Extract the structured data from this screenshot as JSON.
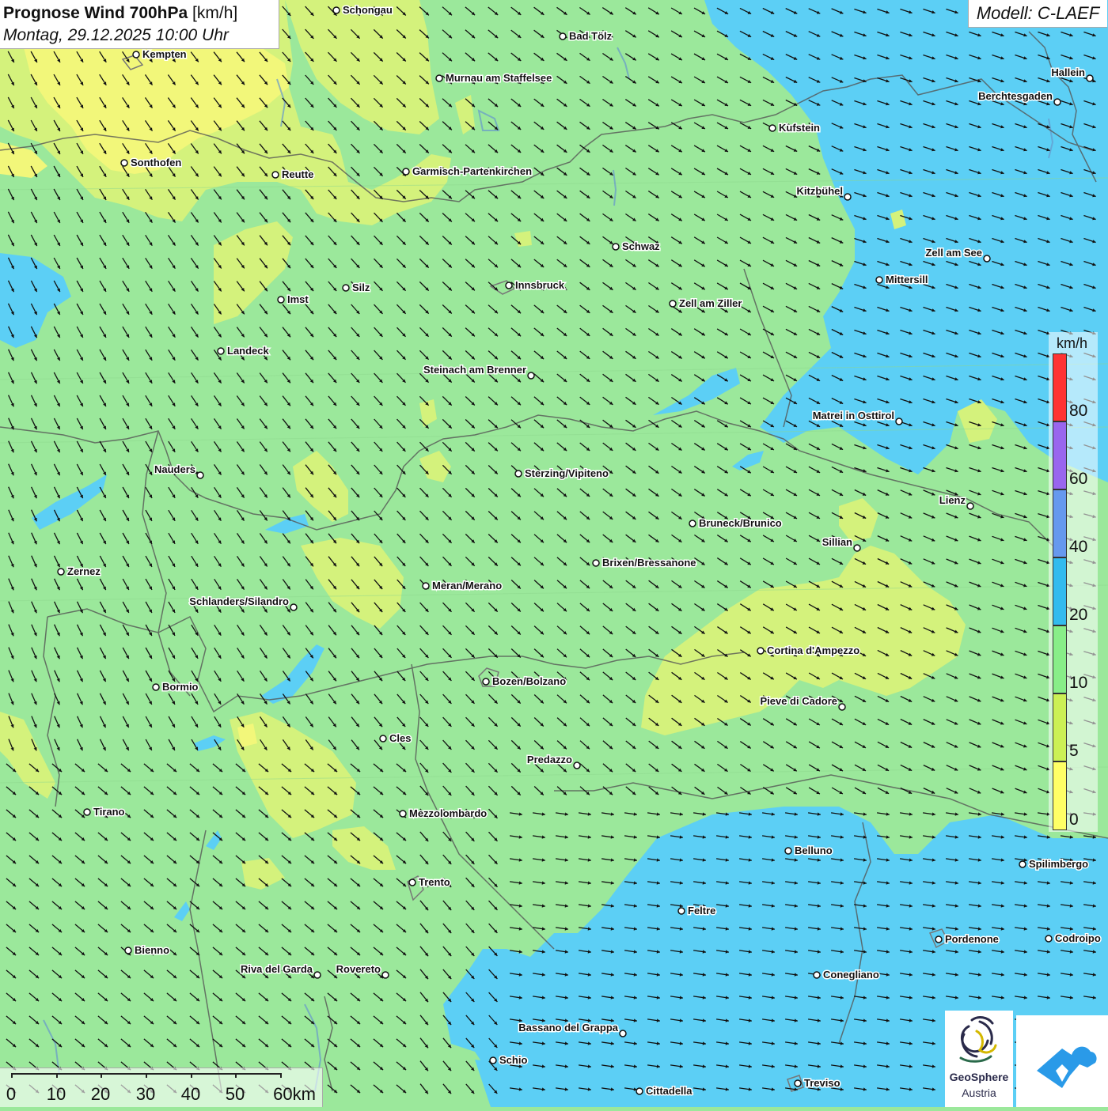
{
  "header": {
    "title_bold": "Prognose Wind 700hPa",
    "title_unit": "[km/h]",
    "datetime": "Montag, 29.12.2025 10:00 Uhr",
    "model": "Modell: C-LAEF"
  },
  "legend": {
    "unit": "km/h",
    "labels": [
      "80",
      "60",
      "40",
      "20",
      "10",
      "5",
      "0"
    ],
    "colors": {
      "above_80": "#ff3333",
      "60_80": "#9966ee",
      "40_60": "#6699ee",
      "20_40": "#33bbee",
      "10_20": "#88ee88",
      "5_10": "#ccf055",
      "0_5": "#ffff66"
    }
  },
  "scale": {
    "labels": [
      "0",
      "10",
      "20",
      "30",
      "40",
      "50",
      "60km"
    ]
  },
  "logos": {
    "geosphere_line1": "GeoSphere",
    "geosphere_line2": "Austria"
  },
  "map_colors": {
    "green": "#9be89b",
    "yellow_green": "#d4f27c",
    "yellow": "#f2f77a",
    "blue": "#5ccff5",
    "border": "#555555",
    "arrow": "#111111"
  },
  "cities": [
    {
      "name": "Schongau",
      "side": "right"
    },
    {
      "name": "Bad Tölz",
      "side": "right"
    },
    {
      "name": "Kempten",
      "side": "right"
    },
    {
      "name": "Murnau am Staffelsee",
      "side": "right"
    },
    {
      "name": "Hallein",
      "side": "left"
    },
    {
      "name": "Berchtesgaden",
      "side": "left"
    },
    {
      "name": "Kufstein",
      "side": "right"
    },
    {
      "name": "Sonthofen",
      "side": "right"
    },
    {
      "name": "Reutte",
      "side": "right"
    },
    {
      "name": "Garmisch-Partenkirchen",
      "side": "right"
    },
    {
      "name": "Kitzbühel",
      "side": "left"
    },
    {
      "name": "Schwaz",
      "side": "right"
    },
    {
      "name": "Zell am See",
      "side": "left"
    },
    {
      "name": "Mittersill",
      "side": "right"
    },
    {
      "name": "Innsbruck",
      "side": "right"
    },
    {
      "name": "Silz",
      "side": "right"
    },
    {
      "name": "Imst",
      "side": "right"
    },
    {
      "name": "Zell am Ziller",
      "side": "right"
    },
    {
      "name": "Landeck",
      "side": "right"
    },
    {
      "name": "Steinach am Brenner",
      "side": "left"
    },
    {
      "name": "Matrei in Osttirol",
      "side": "left"
    },
    {
      "name": "Nauders",
      "side": "left"
    },
    {
      "name": "Sterzing/Vipiteno",
      "side": "right"
    },
    {
      "name": "Lienz",
      "side": "left"
    },
    {
      "name": "Bruneck/Brunico",
      "side": "right"
    },
    {
      "name": "Sillian",
      "side": "left"
    },
    {
      "name": "Zernez",
      "side": "right"
    },
    {
      "name": "Brixen/Bressanone",
      "side": "right"
    },
    {
      "name": "Meran/Merano",
      "side": "right"
    },
    {
      "name": "Schlanders/Silandro",
      "side": "left"
    },
    {
      "name": "Cortina d'Ampezzo",
      "side": "right"
    },
    {
      "name": "Bormio",
      "side": "right"
    },
    {
      "name": "Bozen/Bolzano",
      "side": "right"
    },
    {
      "name": "Pieve di Cadore",
      "side": "left"
    },
    {
      "name": "Cles",
      "side": "right"
    },
    {
      "name": "Predazzo",
      "side": "left"
    },
    {
      "name": "Tirano",
      "side": "right"
    },
    {
      "name": "Mezzolombardo",
      "side": "right"
    },
    {
      "name": "Belluno",
      "side": "right"
    },
    {
      "name": "Spilimbergo",
      "side": "right"
    },
    {
      "name": "Trento",
      "side": "right"
    },
    {
      "name": "Feltre",
      "side": "right"
    },
    {
      "name": "Pordenone",
      "side": "right"
    },
    {
      "name": "Codroipo",
      "side": "right"
    },
    {
      "name": "Bienno",
      "side": "right"
    },
    {
      "name": "Riva del Garda",
      "side": "left"
    },
    {
      "name": "Rovereto",
      "side": "left"
    },
    {
      "name": "Conegliano",
      "side": "right"
    },
    {
      "name": "Bassano del Grappa",
      "side": "left"
    },
    {
      "name": "Schio",
      "side": "right"
    },
    {
      "name": "Treviso",
      "side": "right"
    },
    {
      "name": "Cittadella",
      "side": "right"
    }
  ]
}
